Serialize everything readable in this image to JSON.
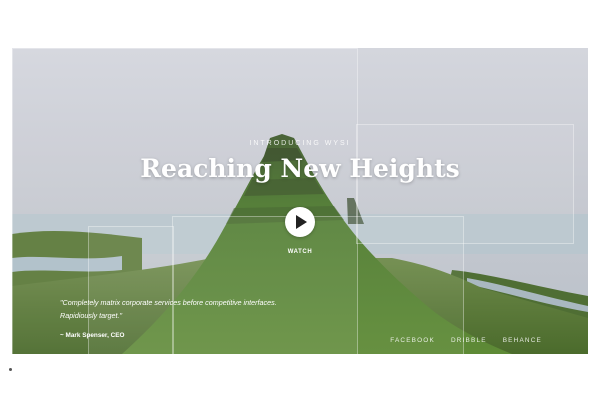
{
  "hero": {
    "eyebrow": "INTRODUCING WYSI",
    "title": "Reaching New Heights",
    "watch_label": "WATCH",
    "quote": "\"Completely matrix corporate services before competitive interfaces. Rapidiously target.\"",
    "author": "~ Mark Spenser, CEO"
  },
  "social": {
    "items": [
      {
        "label": "FACEBOOK"
      },
      {
        "label": "DRIBBLE"
      },
      {
        "label": "BEHANCE"
      }
    ]
  },
  "colors": {
    "sky": "#c9ccd3",
    "mountain": "#4f7a2f",
    "water": "#b7c6cf",
    "text": "#ffffff"
  }
}
